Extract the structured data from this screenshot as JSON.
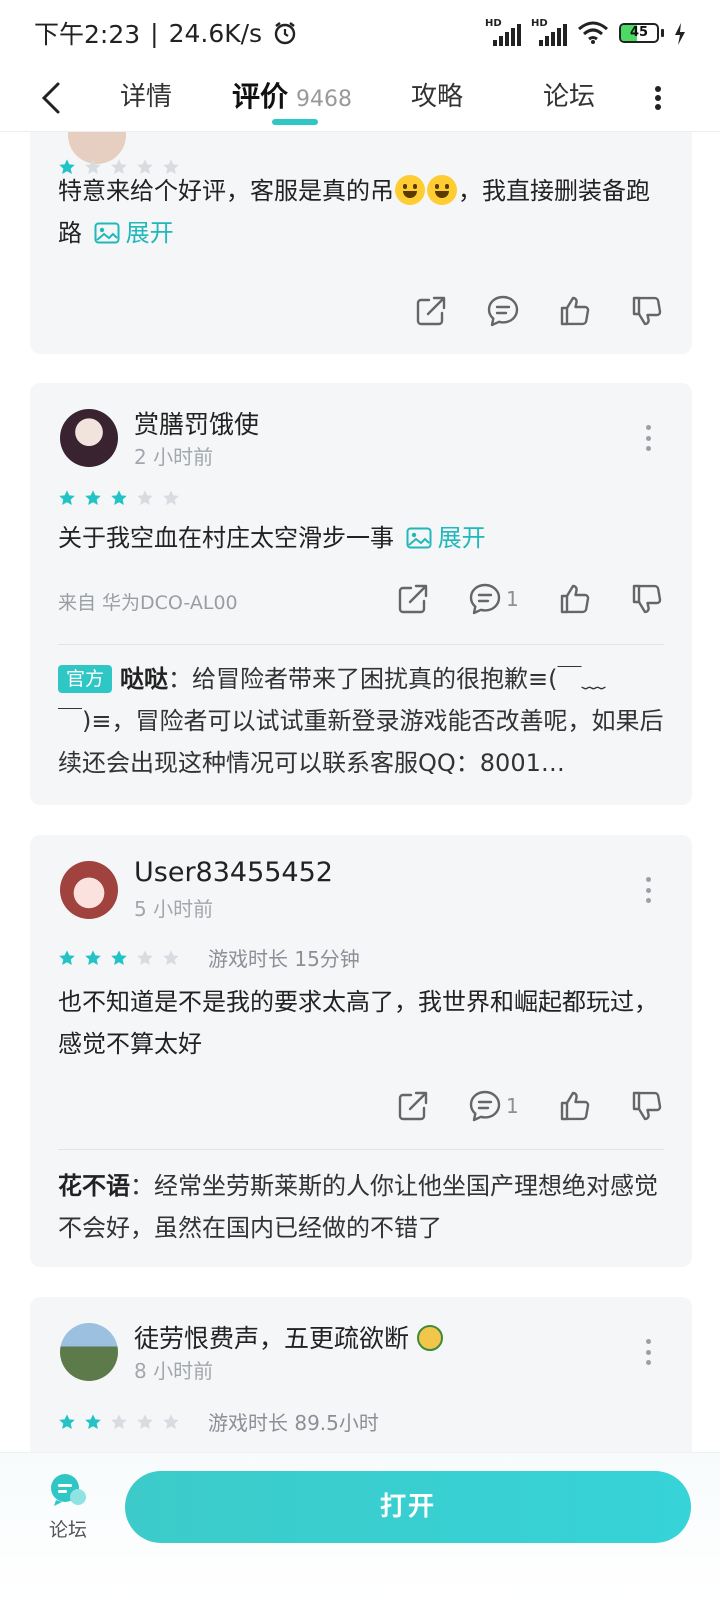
{
  "status_bar": {
    "time": "下午2:23",
    "separator": "|",
    "net_speed": "24.6K/s",
    "signal_1_label": "HD",
    "signal_2_label": "HD",
    "battery": "45",
    "battery_level": 0.45,
    "icons": [
      "alarm-icon",
      "signal-icon",
      "signal-icon",
      "wifi-icon",
      "battery-icon",
      "charging-icon"
    ]
  },
  "nav": {
    "tabs": [
      {
        "label": "详情"
      },
      {
        "label": "评价",
        "count": "9468",
        "active": true
      },
      {
        "label": "攻略"
      },
      {
        "label": "论坛"
      }
    ]
  },
  "reviews": [
    {
      "stars": 1,
      "content": "特意来给个好评，客服是真的吊",
      "content_after_emoji": "，我直接删装备跑路",
      "expand_label": "展开"
    },
    {
      "user": "赏膳罚饿使",
      "time": "2 小时前",
      "stars": 3,
      "content": "关于我空血在村庄太空滑步一事",
      "expand_label": "展开",
      "device": "来自 华为DCO-AL00",
      "comment_count": "1",
      "reply": {
        "badge": "官方",
        "author": "哒哒",
        "text": "：给冒险者带来了困扰真的很抱歉≡(￣﹏￣)≡，冒险者可以试试重新登录游戏能否改善呢，如果后续还会出现这种情况可以联系客服QQ：8001…"
      }
    },
    {
      "user": "User83455452",
      "time": "5 小时前",
      "stars": 3,
      "playtime": "游戏时长 15分钟",
      "content": "也不知道是不是我的要求太高了，我世界和崛起都玩过，感觉不算太好",
      "comment_count": "1",
      "reply": {
        "author": "花不语",
        "text": "：经常坐劳斯莱斯的人你让他坐国产理想绝对感觉不会好，虽然在国内已经做的不错了"
      }
    },
    {
      "user": "徒劳恨费声，五更疏欲断",
      "time": "8 小时前",
      "stars": 2,
      "playtime": "游戏时长 89.5小时"
    }
  ],
  "bottom": {
    "forum_label": "论坛",
    "open_label": "打开"
  },
  "colors": {
    "accent": "#2fc6c6",
    "star_on": "#22c3c6",
    "star_off": "#d8dbe0",
    "card_bg": "#f5f6f8"
  }
}
